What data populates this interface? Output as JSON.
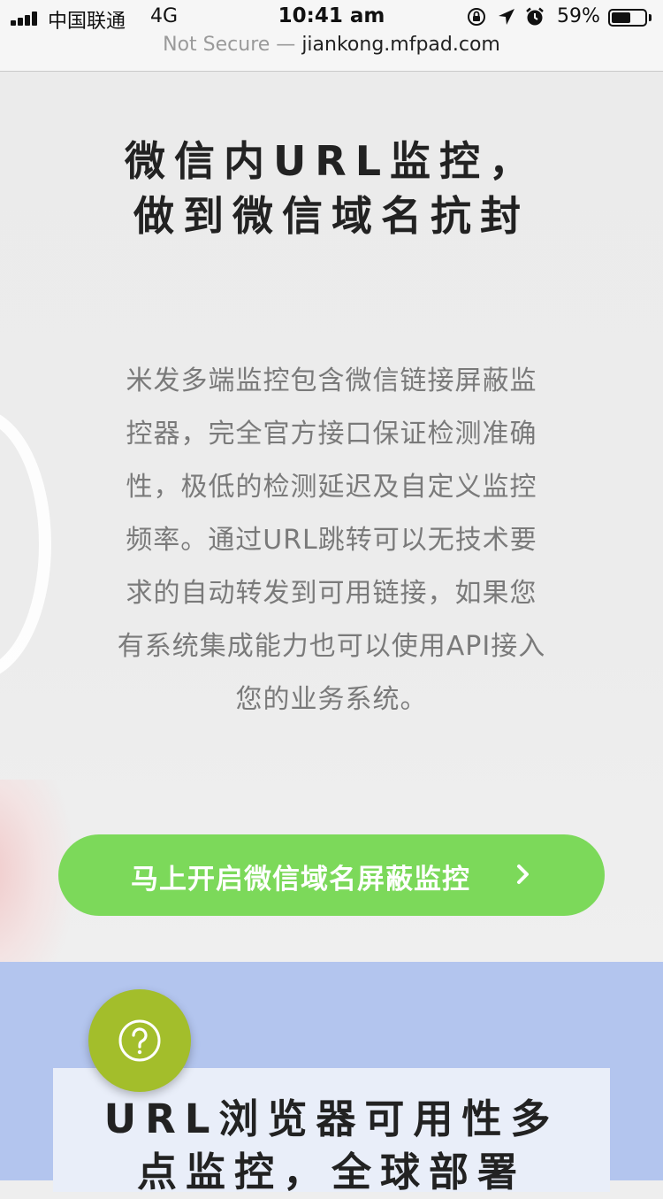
{
  "status_bar": {
    "carrier": "中国联通",
    "network": "4G",
    "time": "10:41 am",
    "battery_percent": "59%",
    "battery_level": 0.59,
    "icons": [
      "signal-icon",
      "screen-lock-icon",
      "location-icon",
      "alarm-icon",
      "battery-icon"
    ]
  },
  "address_bar": {
    "security": "Not Secure —",
    "domain": "jiankong.mfpad.com"
  },
  "hero": {
    "title_line1": "微信内URL监控，",
    "title_line2": "做到微信域名抗封",
    "description_lines": [
      "米发多端监控包含微信链接屏蔽监",
      "控器，完全官方接口保证检测准确",
      "性，极低的检测延迟及自定义监控",
      "频率。通过URL跳转可以无技术要",
      "求的自动转发到可用链接，如果您",
      "有系统集成能力也可以使用API接入",
      "您的业务系统。"
    ],
    "cta_label": "马上开启微信域名屏蔽监控"
  },
  "section2": {
    "title_line1": "URL浏览器可用性多",
    "title_line2": "点监控，全球部署"
  },
  "help_button": {
    "icon": "question-icon"
  },
  "colors": {
    "cta": "#7cd95a",
    "section2_bg": "#b3c5ee",
    "card_bg": "#e9eef9",
    "help_button": "#a3be2b"
  }
}
